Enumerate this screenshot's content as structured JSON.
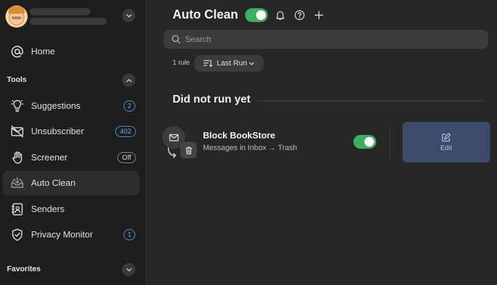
{
  "sidebar": {
    "home_label": "Home",
    "tools_section": "Tools",
    "items": [
      {
        "label": "Suggestions",
        "icon": "lightbulb-icon",
        "badge": "2"
      },
      {
        "label": "Unsubscriber",
        "icon": "mail-off-icon",
        "badge": "402"
      },
      {
        "label": "Screener",
        "icon": "hand-icon",
        "badge": "Off"
      },
      {
        "label": "Auto Clean",
        "icon": "inbox-clean-icon",
        "badge": ""
      },
      {
        "label": "Senders",
        "icon": "contacts-book-icon",
        "badge": ""
      },
      {
        "label": "Privacy Monitor",
        "icon": "shield-check-icon",
        "badge": "1"
      }
    ],
    "favorites_section": "Favorites"
  },
  "header": {
    "title": "Auto Clean",
    "enabled": true
  },
  "search": {
    "placeholder": "Search"
  },
  "toolbar": {
    "rule_count": "1 rule",
    "sort_label": "Last Run"
  },
  "group": {
    "title": "Did not run yet"
  },
  "rule": {
    "name": "Block BookStore",
    "description": "Messages in Inbox → Trash",
    "enabled": true,
    "edit_label": "Edit"
  },
  "colors": {
    "accent_green": "#3fae5e",
    "badge_blue": "#4d8fd6",
    "edit_bg": "#3d4a68"
  }
}
